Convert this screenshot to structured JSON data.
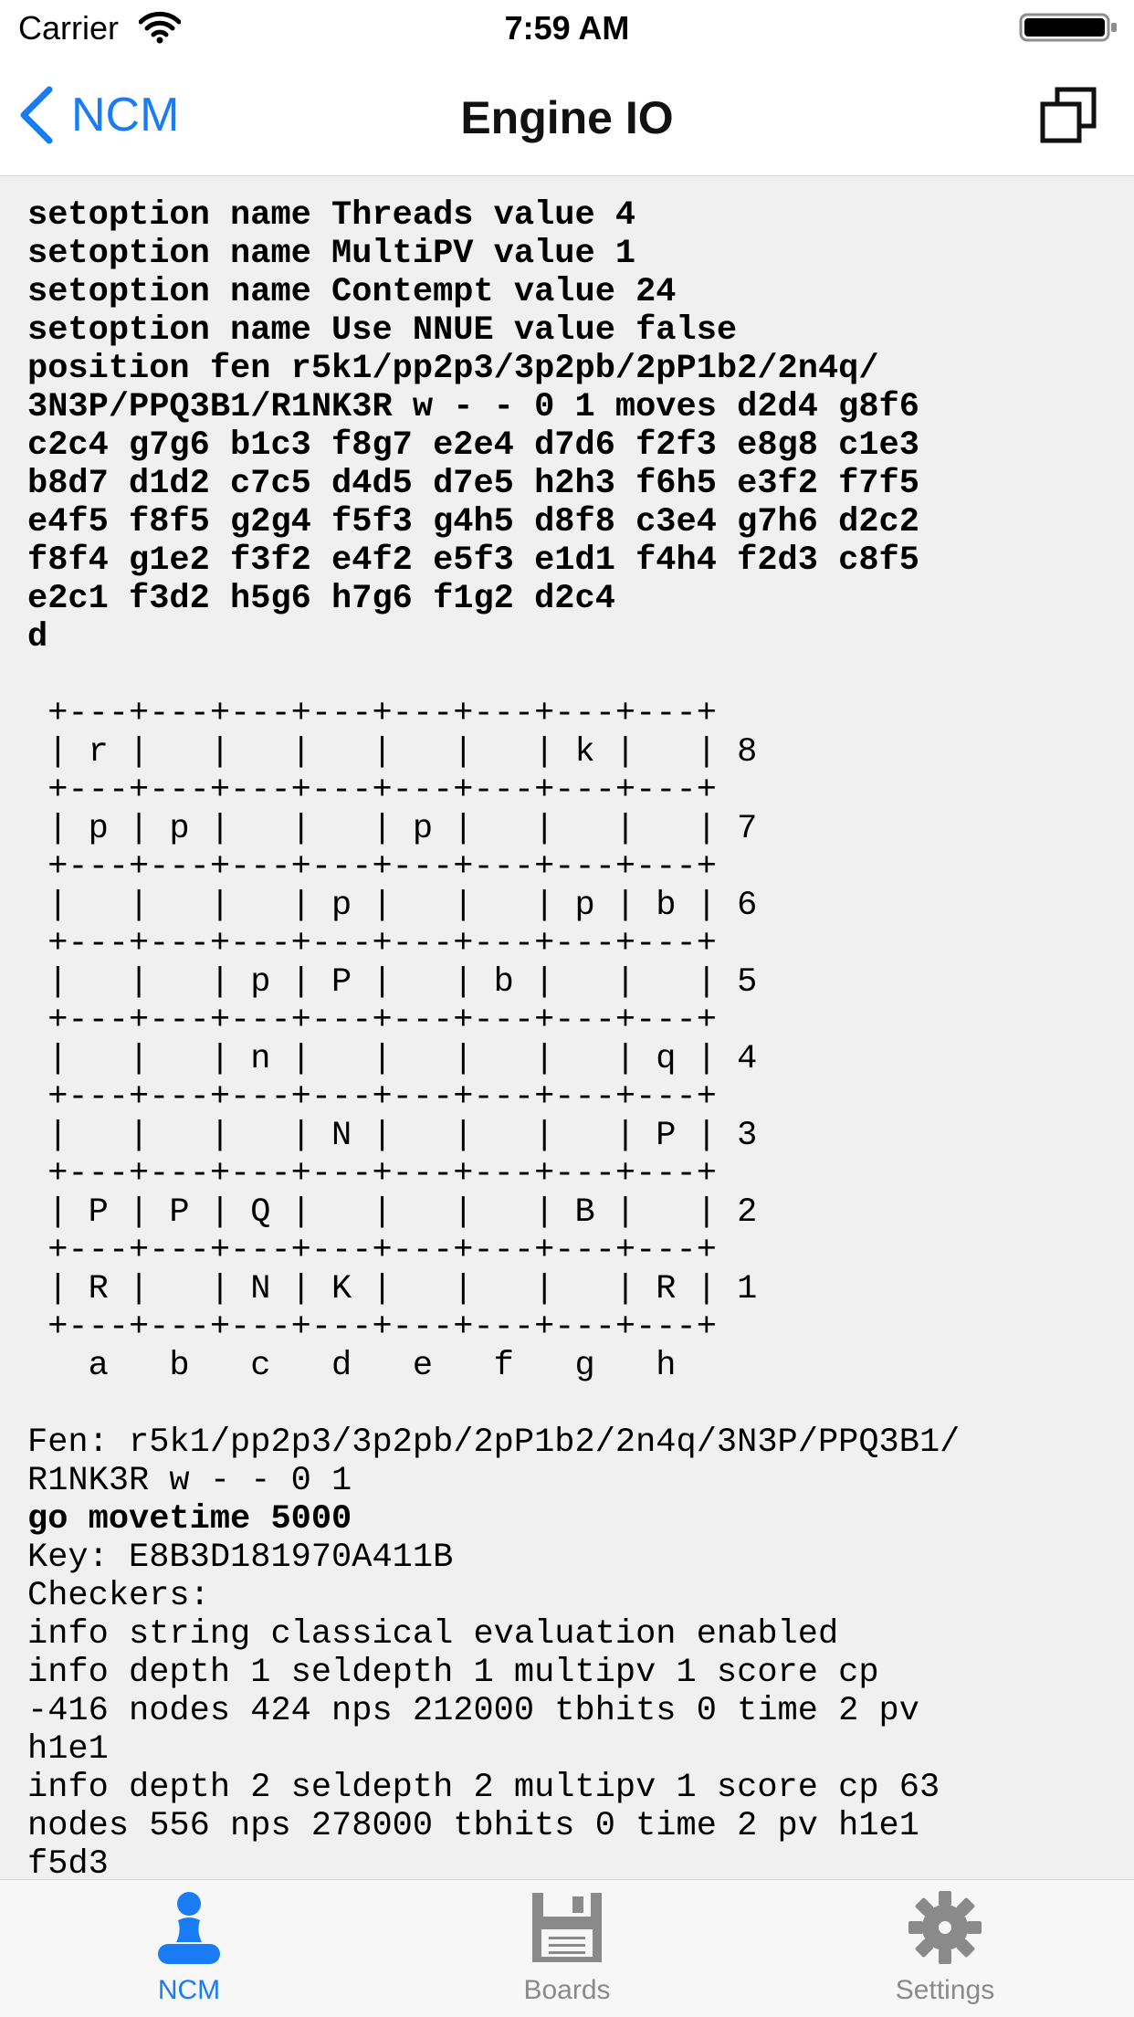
{
  "status_bar": {
    "carrier": "Carrier",
    "time": "7:59 AM"
  },
  "nav": {
    "back_label": "NCM",
    "title": "Engine IO"
  },
  "console": {
    "lines": [
      {
        "text": "setoption name Threads value 4",
        "bold": true
      },
      {
        "text": "setoption name MultiPV value 1",
        "bold": true
      },
      {
        "text": "setoption name Contempt value 24",
        "bold": true
      },
      {
        "text": "setoption name Use NNUE value false",
        "bold": true
      },
      {
        "text": "position fen r5k1/pp2p3/3p2pb/2pP1b2/2n4q/",
        "bold": true
      },
      {
        "text": "3N3P/PPQ3B1/R1NK3R w - - 0 1 moves d2d4 g8f6",
        "bold": true
      },
      {
        "text": "c2c4 g7g6 b1c3 f8g7 e2e4 d7d6 f2f3 e8g8 c1e3",
        "bold": true
      },
      {
        "text": "b8d7 d1d2 c7c5 d4d5 d7e5 h2h3 f6h5 e3f2 f7f5",
        "bold": true
      },
      {
        "text": "e4f5 f8f5 g2g4 f5f3 g4h5 d8f8 c3e4 g7h6 d2c2",
        "bold": true
      },
      {
        "text": "f8f4 g1e2 f3f2 e4f2 e5f3 e1d1 f4h4 f2d3 c8f5",
        "bold": true
      },
      {
        "text": "e2c1 f3d2 h5g6 h7g6 f1g2 d2c4",
        "bold": true
      },
      {
        "text": "d",
        "bold": true
      },
      {
        "text": "",
        "bold": false
      },
      {
        "text": " +---+---+---+---+---+---+---+---+",
        "bold": false
      },
      {
        "text": " | r |   |   |   |   |   | k |   | 8",
        "bold": false
      },
      {
        "text": " +---+---+---+---+---+---+---+---+",
        "bold": false
      },
      {
        "text": " | p | p |   |   | p |   |   |   | 7",
        "bold": false
      },
      {
        "text": " +---+---+---+---+---+---+---+---+",
        "bold": false
      },
      {
        "text": " |   |   |   | p |   |   | p | b | 6",
        "bold": false
      },
      {
        "text": " +---+---+---+---+---+---+---+---+",
        "bold": false
      },
      {
        "text": " |   |   | p | P |   | b |   |   | 5",
        "bold": false
      },
      {
        "text": " +---+---+---+---+---+---+---+---+",
        "bold": false
      },
      {
        "text": " |   |   | n |   |   |   |   | q | 4",
        "bold": false
      },
      {
        "text": " +---+---+---+---+---+---+---+---+",
        "bold": false
      },
      {
        "text": " |   |   |   | N |   |   |   | P | 3",
        "bold": false
      },
      {
        "text": " +---+---+---+---+---+---+---+---+",
        "bold": false
      },
      {
        "text": " | P | P | Q |   |   |   | B |   | 2",
        "bold": false
      },
      {
        "text": " +---+---+---+---+---+---+---+---+",
        "bold": false
      },
      {
        "text": " | R |   | N | K |   |   |   | R | 1",
        "bold": false
      },
      {
        "text": " +---+---+---+---+---+---+---+---+",
        "bold": false
      },
      {
        "text": "   a   b   c   d   e   f   g   h",
        "bold": false
      },
      {
        "text": "",
        "bold": false
      },
      {
        "text": "Fen: r5k1/pp2p3/3p2pb/2pP1b2/2n4q/3N3P/PPQ3B1/",
        "bold": false
      },
      {
        "text": "R1NK3R w - - 0 1",
        "bold": false
      },
      {
        "text": "go movetime 5000",
        "bold": true
      },
      {
        "text": "Key: E8B3D181970A411B",
        "bold": false
      },
      {
        "text": "Checkers:",
        "bold": false
      },
      {
        "text": "info string classical evaluation enabled",
        "bold": false
      },
      {
        "text": "info depth 1 seldepth 1 multipv 1 score cp",
        "bold": false
      },
      {
        "text": "-416 nodes 424 nps 212000 tbhits 0 time 2 pv",
        "bold": false
      },
      {
        "text": "h1e1",
        "bold": false
      },
      {
        "text": "info depth 2 seldepth 2 multipv 1 score cp 63",
        "bold": false
      },
      {
        "text": "nodes 556 nps 278000 tbhits 0 time 2 pv h1e1",
        "bold": false
      },
      {
        "text": "f5d3",
        "bold": false
      }
    ]
  },
  "tabs": [
    {
      "key": "ncm",
      "label": "NCM",
      "icon": "pawn-icon",
      "active": true
    },
    {
      "key": "boards",
      "label": "Boards",
      "icon": "floppy-disk-icon",
      "active": false
    },
    {
      "key": "settings",
      "label": "Settings",
      "icon": "gear-icon",
      "active": false
    }
  ],
  "colors": {
    "accent": "#1a7cf5",
    "inactive": "#8a8a8a",
    "console_background": "#f0f0f0",
    "bar_background": "#ffffff"
  }
}
